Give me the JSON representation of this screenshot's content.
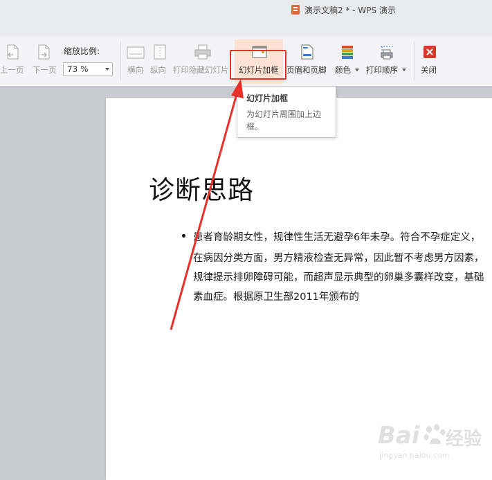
{
  "window": {
    "title": "演示文稿2 * - WPS 演示",
    "doc_icon": "wps-presentation-icon",
    "accent": "#d96b3a"
  },
  "ribbon": {
    "prev_page": "上一页",
    "next_page": "下一页",
    "zoom_label": "缩放比例:",
    "zoom_value": "73 %",
    "landscape": "横向",
    "portrait": "纵向",
    "print_hidden": "打印隐藏幻灯片",
    "slide_frame": "幻灯片加框",
    "header_footer": "页眉和页脚",
    "color": "颜色",
    "print_order": "打印顺序",
    "close": "关闭"
  },
  "tooltip": {
    "title": "幻灯片加框",
    "description": "为幻灯片周围加上边框。"
  },
  "slide": {
    "title": "诊断思路",
    "lines": [
      "患者育龄期女性，规律性生活无避孕6年未孕。符合不孕症定义，",
      "在病因分类方面，男方精液检查无异常，因此暂不考虑男方因素，",
      "规律提示排卵障碍可能，而超声显示典型的卵巢多囊样改变，基础",
      "素血症。根据原卫生部2011年颁布的"
    ]
  },
  "annotation": {
    "color": "#e8302a"
  },
  "watermark": {
    "brand": "Bai",
    "brand_suffix": "经验",
    "url": "jingyan.baidu.com"
  }
}
